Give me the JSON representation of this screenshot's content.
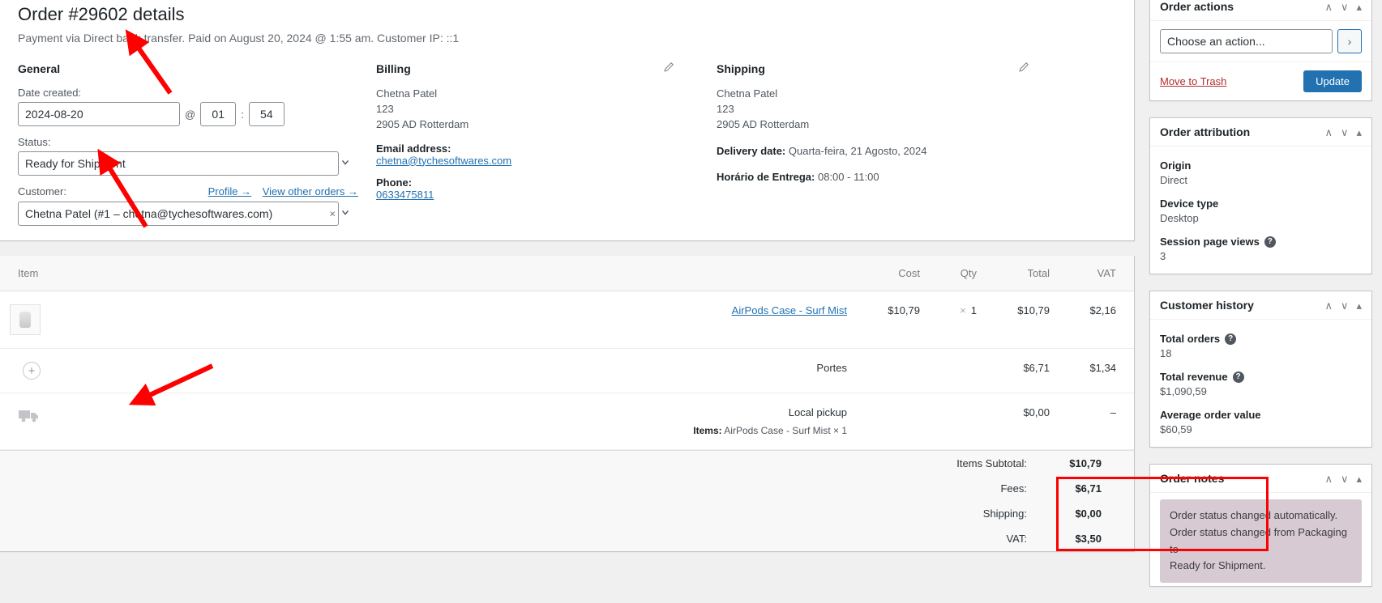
{
  "order": {
    "title": "Order #29602 details",
    "subtitle": "Payment via Direct bank transfer. Paid on August 20, 2024 @ 1:55 am. Customer IP: ::1"
  },
  "general": {
    "heading": "General",
    "date_label": "Date created:",
    "date_value": "2024-08-20",
    "at_symbol": "@",
    "hour_value": "01",
    "colon": ":",
    "minute_value": "54",
    "status_label": "Status:",
    "status_value": "Ready for Shipment",
    "customer_label": "Customer:",
    "profile_link": "Profile →",
    "other_orders_link": "View other orders →",
    "customer_value": "Chetna Patel (#1 – chetna@tychesoftwares.com)",
    "clear_x": "×"
  },
  "billing": {
    "heading": "Billing",
    "name": "Chetna Patel",
    "address1": "123",
    "address2": "2905 AD Rotterdam",
    "email_label": "Email address:",
    "email_value": "chetna@tychesoftwares.com",
    "phone_label": "Phone:",
    "phone_value": "0633475811"
  },
  "shipping": {
    "heading": "Shipping",
    "name": "Chetna Patel",
    "address1": "123",
    "address2": "2905 AD Rotterdam",
    "delivery_date_label": "Delivery date:",
    "delivery_date_value": "Quarta-feira, 21 Agosto, 2024",
    "delivery_time_label": "Horário de Entrega:",
    "delivery_time_value": "08:00 - 11:00"
  },
  "items_table": {
    "columns": [
      "Item",
      "Cost",
      "Qty",
      "Total",
      "VAT"
    ],
    "rows": [
      {
        "type": "product",
        "name": "AirPods Case - Surf Mist",
        "cost": "$10,79",
        "qty_x": "×",
        "qty": "1",
        "total": "$10,79",
        "vat": "$2,16"
      },
      {
        "type": "fee",
        "name": "Portes",
        "cost": "",
        "qty_x": "",
        "qty": "",
        "total": "$6,71",
        "vat": "$1,34"
      },
      {
        "type": "shipping",
        "name": "Local pickup",
        "items_label": "Items:",
        "items_value": "AirPods Case - Surf Mist × 1",
        "cost": "",
        "qty_x": "",
        "qty": "",
        "total": "$0,00",
        "vat": "–"
      }
    ]
  },
  "totals": [
    {
      "label": "Items Subtotal:",
      "value": "$10,79"
    },
    {
      "label": "Fees:",
      "value": "$6,71"
    },
    {
      "label": "Shipping:",
      "value": "$0,00"
    },
    {
      "label": "VAT:",
      "value": "$3,50"
    }
  ],
  "sidebar": {
    "order_actions": {
      "title": "Order actions",
      "action_select_value": "Choose an action...",
      "go_label": "›",
      "trash_label": "Move to Trash",
      "update_label": "Update"
    },
    "order_attribution": {
      "title": "Order attribution",
      "fields": [
        {
          "label": "Origin",
          "value": "Direct",
          "help": false
        },
        {
          "label": "Device type",
          "value": "Desktop",
          "help": false
        },
        {
          "label": "Session page views",
          "value": "3",
          "help": true
        }
      ]
    },
    "customer_history": {
      "title": "Customer history",
      "fields": [
        {
          "label": "Total orders",
          "value": "18",
          "help": true
        },
        {
          "label": "Total revenue",
          "value": "$1,090,59",
          "help": true
        },
        {
          "label": "Average order value",
          "value": "$60,59",
          "help": false
        }
      ]
    },
    "order_notes": {
      "title": "Order notes",
      "notes": [
        {
          "line1": "Order status changed automatically.",
          "line2": "Order status changed from Packaging to",
          "line3": "Ready for Shipment."
        }
      ]
    },
    "panel_controls": {
      "up": "∧",
      "down": "∨",
      "toggle": "▴"
    }
  },
  "colors": {
    "accent": "#2271b1",
    "danger": "#b32d2e",
    "annotation": "#ff0000",
    "note_bg": "#d7cad2"
  }
}
